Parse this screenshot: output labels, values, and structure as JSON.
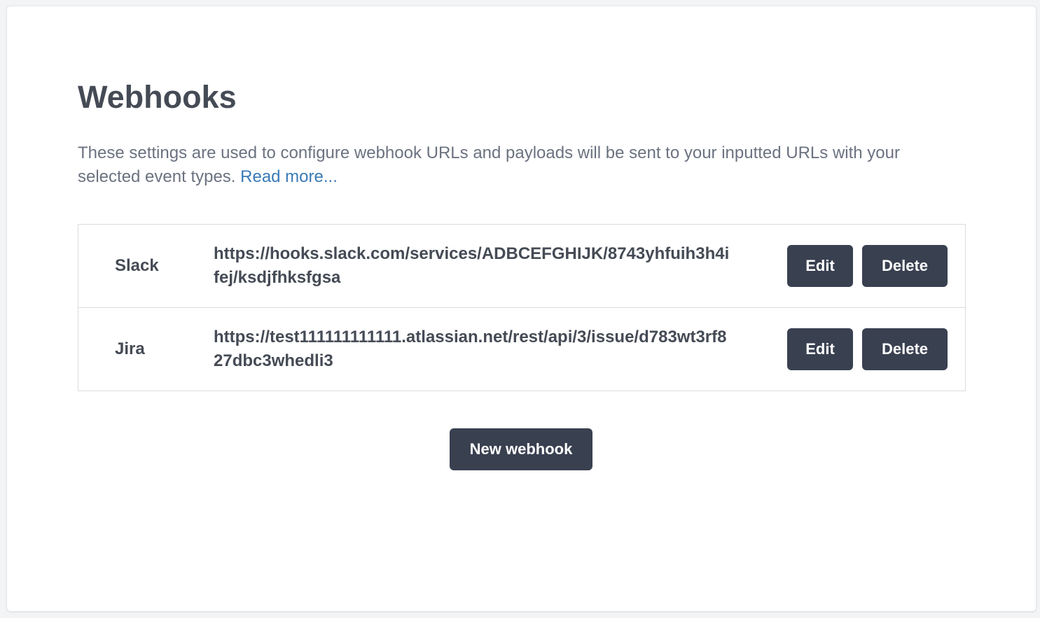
{
  "page": {
    "title": "Webhooks",
    "description": "These settings are used to configure webhook URLs and payloads will be sent to your inputted URLs with your selected event types.",
    "read_more_label": "Read more..."
  },
  "webhooks": [
    {
      "name": "Slack",
      "url": "https://hooks.slack.com/services/ADBCEFGHIJK/8743yhfuih3h4ifej/ksdjfhksfgsa",
      "edit_label": "Edit",
      "delete_label": "Delete"
    },
    {
      "name": "Jira",
      "url": "https://test111111111111.atlassian.net/rest/api/3/issue/d783wt3rf827dbc3whedli3",
      "edit_label": "Edit",
      "delete_label": "Delete"
    }
  ],
  "actions": {
    "new_webhook_label": "New webhook"
  },
  "colors": {
    "button_bg": "#394050",
    "link": "#3a7ab6",
    "heading": "#454b55",
    "muted_text": "#6b7280"
  }
}
